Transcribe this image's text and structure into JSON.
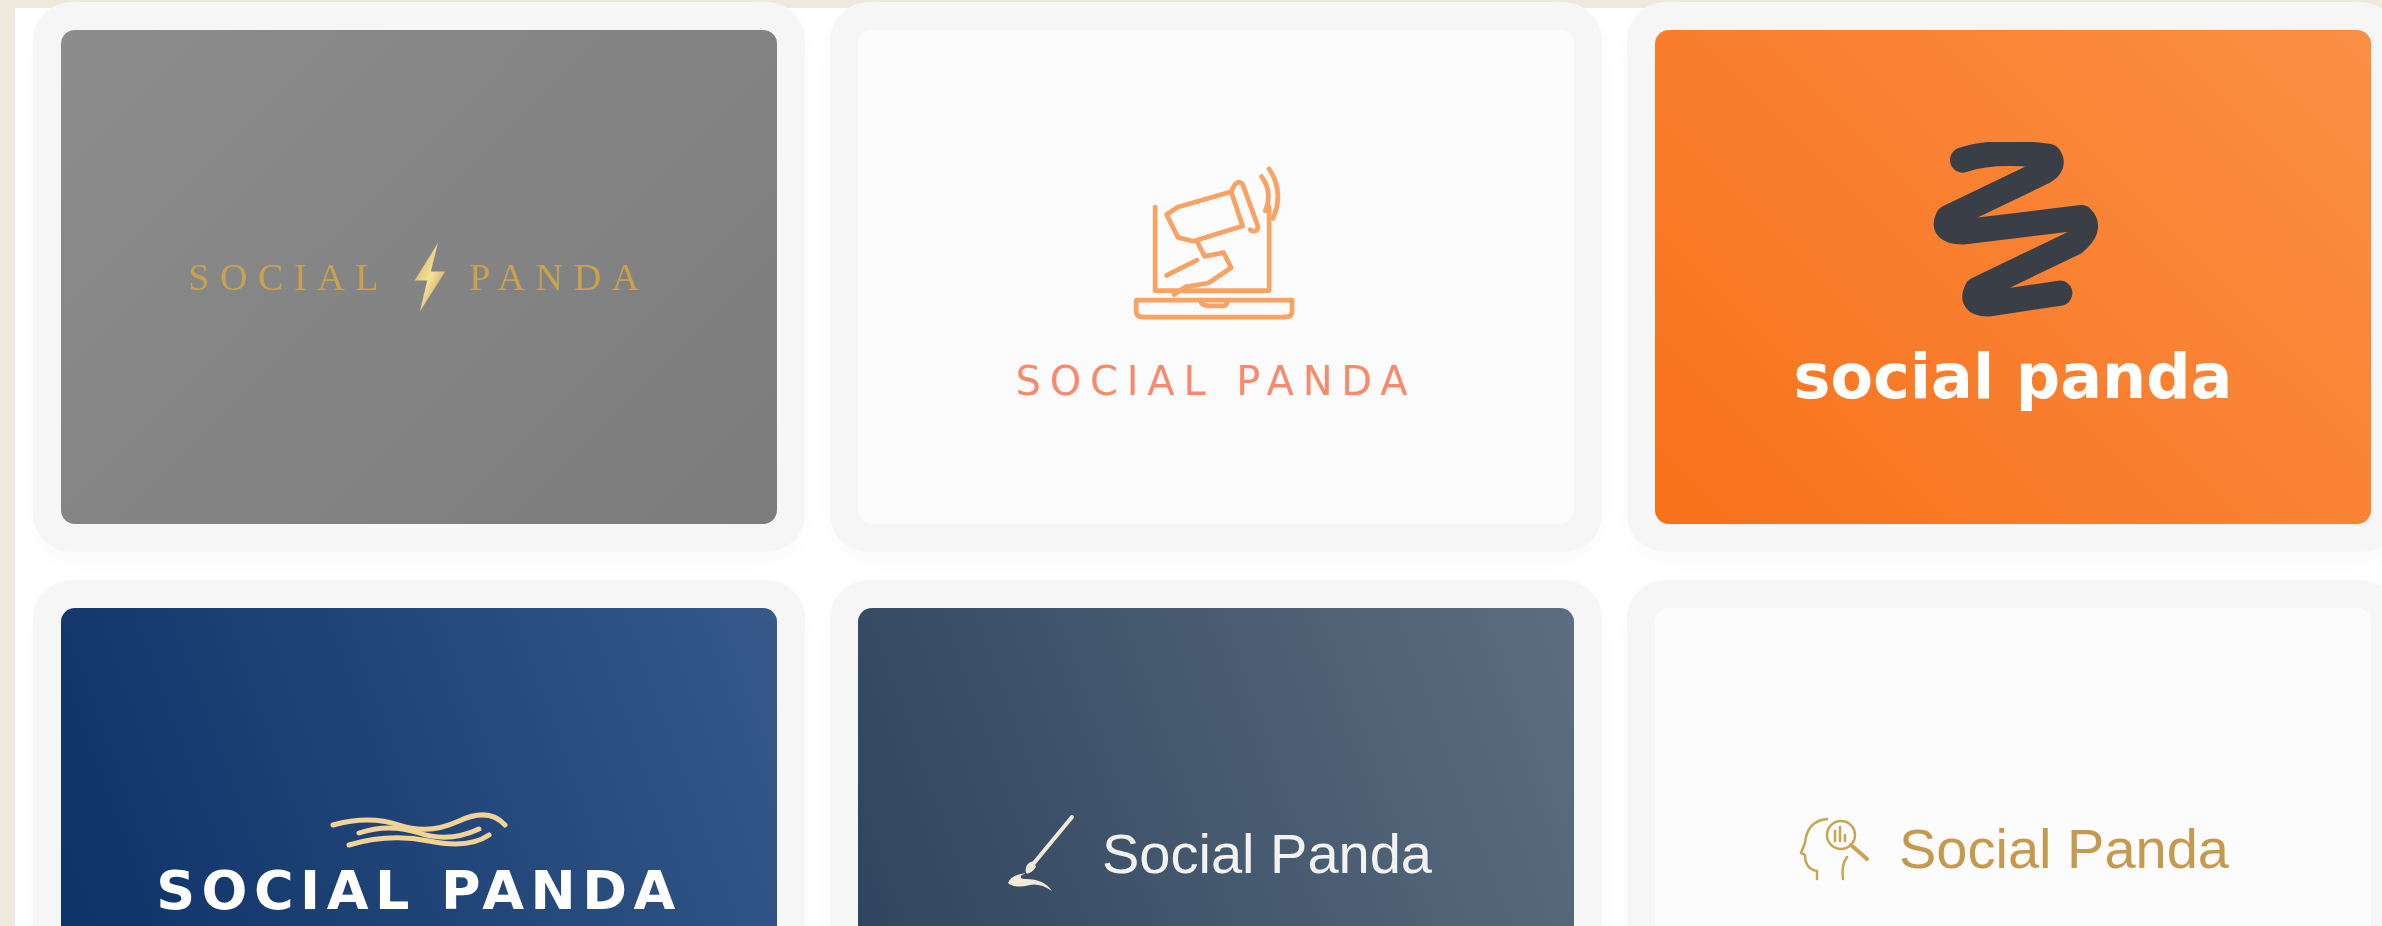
{
  "logos": [
    {
      "kind": "bolt",
      "words": [
        "SOCIAL",
        "PANDA"
      ]
    },
    {
      "kind": "megaphone",
      "words": [
        "SOCIAL PANDA"
      ]
    },
    {
      "kind": "squiggle",
      "words": [
        "social panda"
      ]
    },
    {
      "kind": "wave",
      "words": [
        "SOCIAL PANDA"
      ]
    },
    {
      "kind": "brush",
      "words": [
        "Social Panda"
      ]
    },
    {
      "kind": "head",
      "words": [
        "Social Panda"
      ]
    }
  ]
}
